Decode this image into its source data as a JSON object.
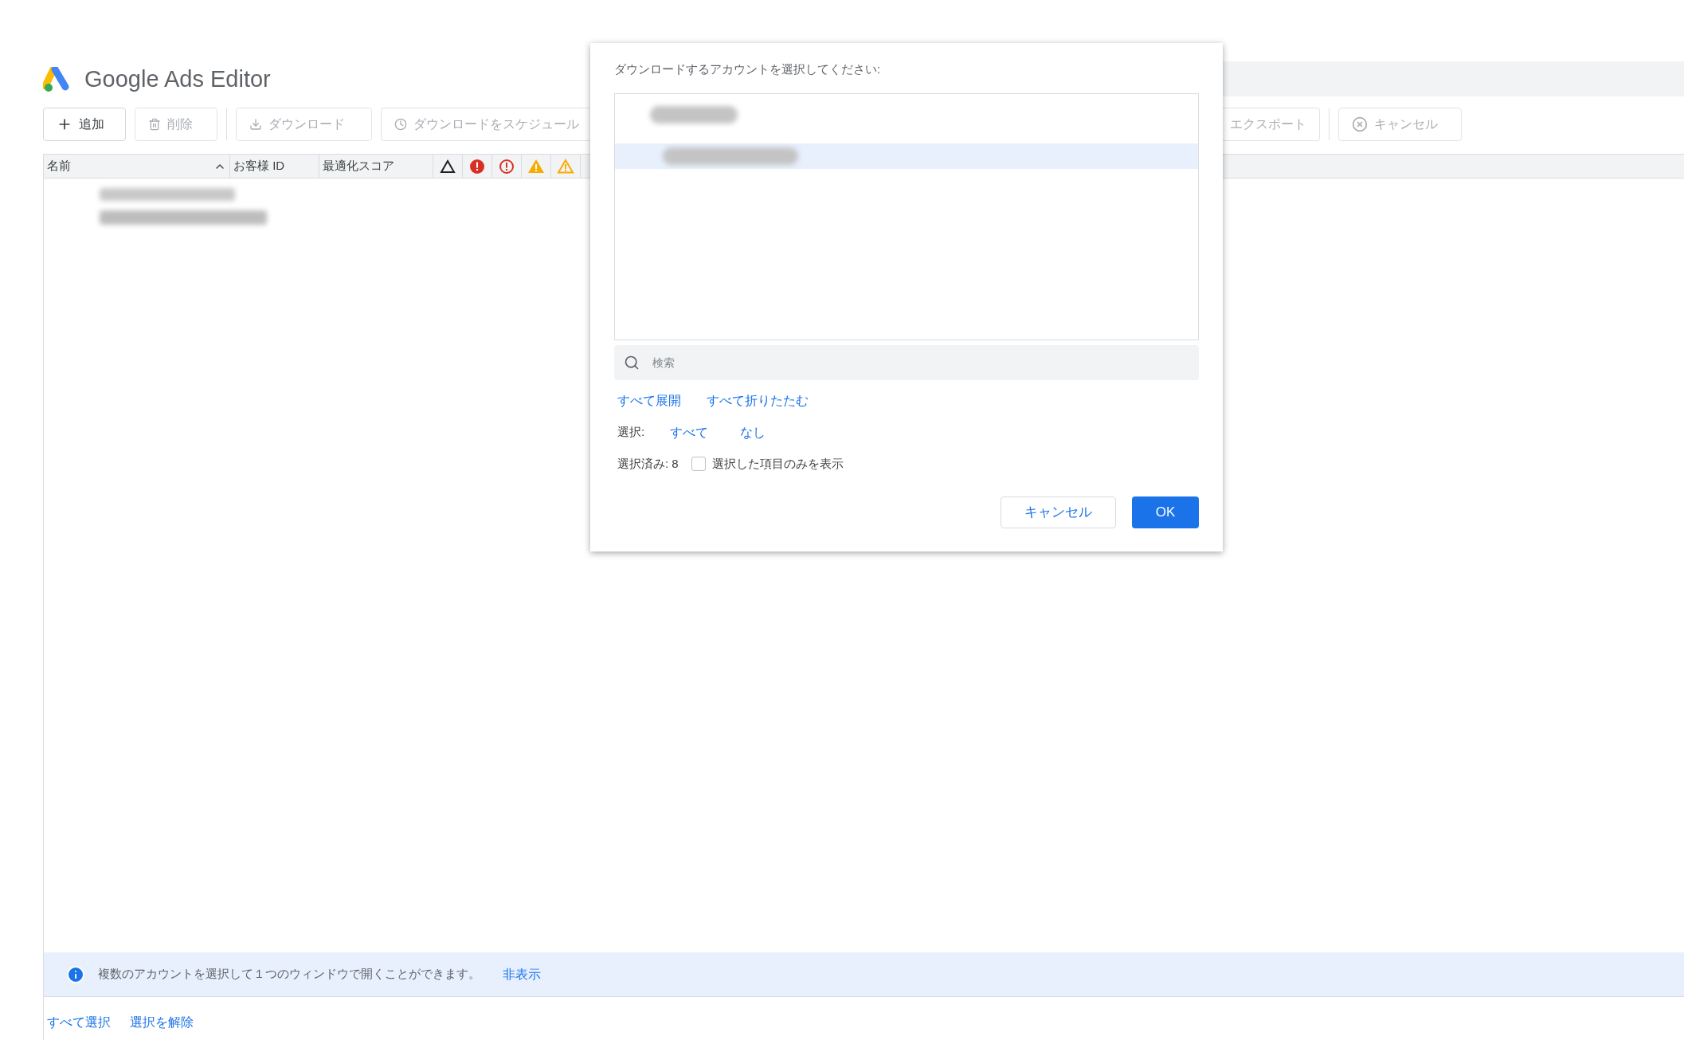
{
  "app": {
    "title": "Google Ads Editor"
  },
  "toolbar_left": [
    {
      "label": "追加",
      "disabled": false
    },
    {
      "label": "削除",
      "disabled": true
    },
    {
      "label": "ダウンロード",
      "disabled": true
    },
    {
      "label": "ダウンロードをスケジュール",
      "disabled": true
    }
  ],
  "toolbar_right": [
    {
      "label": "エクスポート",
      "disabled": true
    },
    {
      "label": "キャンセル",
      "disabled": true
    }
  ],
  "table": {
    "columns": [
      {
        "kind": "text",
        "label": "名前",
        "sorted": true
      },
      {
        "kind": "text",
        "label": "お客様 ID",
        "sorted": false
      },
      {
        "kind": "text",
        "label": "最適化スコア",
        "sorted": false
      },
      {
        "kind": "triangle-outline"
      },
      {
        "kind": "error-filled"
      },
      {
        "kind": "error-outline"
      },
      {
        "kind": "warning-filled"
      },
      {
        "kind": "warning-outline"
      }
    ]
  },
  "dialog": {
    "prompt": "ダウンロードするアカウントを選択してください:",
    "accounts": [
      {
        "selected": false
      },
      {
        "selected": true
      }
    ],
    "search": {
      "placeholder": "検索"
    },
    "tree_links": [
      "すべて展開",
      "すべて折りたたむ"
    ],
    "select_label": "選択:",
    "select_links": [
      "すべて",
      "なし"
    ],
    "selected_count": "選択済み: 8",
    "show_selected_only": {
      "label": "選択した項目のみを表示",
      "checked": false
    },
    "buttons": [
      {
        "kind": "secondary",
        "label": "キャンセル"
      },
      {
        "kind": "primary",
        "label": "OK"
      }
    ]
  },
  "info_bar": {
    "message": "複数のアカウントを選択して１つのウィンドウで開くことができます。",
    "hide_link": "非表示"
  },
  "footer_links": [
    "すべて選択",
    "選択を解除"
  ]
}
